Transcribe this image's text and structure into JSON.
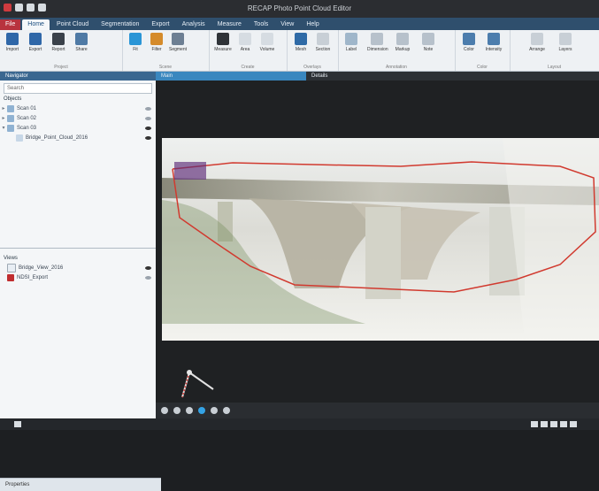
{
  "app": {
    "title": "RECAP Photo Point Cloud Editor",
    "theme": {
      "ribbon_blue": "#3a6790",
      "tab_blue": "#3a87bf",
      "red": "#b8333e"
    }
  },
  "ribbon": {
    "tabs": [
      "File",
      "Home",
      "Point Cloud",
      "Segmentation",
      "Export",
      "Analysis",
      "Measure",
      "Tools",
      "View",
      "Help"
    ],
    "active_tab": "Home",
    "groups": [
      {
        "name": "Project",
        "buttons": [
          "Import",
          "Export",
          "Report",
          "Share"
        ]
      },
      {
        "name": "Scene",
        "buttons": [
          "Fit",
          "Filter",
          "Segment"
        ]
      },
      {
        "name": "Create",
        "buttons": [
          "Measure",
          "Area",
          "Volume"
        ]
      },
      {
        "name": "Overlays",
        "buttons": [
          "Mesh",
          "Section"
        ]
      },
      {
        "name": "Annotation",
        "buttons": [
          "Label",
          "Dimension",
          "Markup",
          "Note"
        ]
      },
      {
        "name": "Color",
        "buttons": [
          "Color",
          "Intensity"
        ]
      },
      {
        "name": "Layout",
        "buttons": [
          "Arrange",
          "Layers"
        ]
      }
    ]
  },
  "left_panel": {
    "header": "Navigator",
    "search_placeholder": "Search",
    "section1": "Objects",
    "tree": [
      {
        "label": "Scan 01",
        "expanded": false
      },
      {
        "label": "Scan 02",
        "expanded": false
      },
      {
        "label": "Scan 03",
        "expanded": true,
        "children": [
          {
            "label": "Bridge_Point_Cloud_2016"
          }
        ]
      }
    ],
    "section2": "Views",
    "views": [
      {
        "label": "Bridge_View_2016"
      },
      {
        "label": "NDSI_Export"
      }
    ],
    "footer": "Properties"
  },
  "main": {
    "tabs": [
      "Main",
      "Details"
    ],
    "active_tab": "Main"
  }
}
